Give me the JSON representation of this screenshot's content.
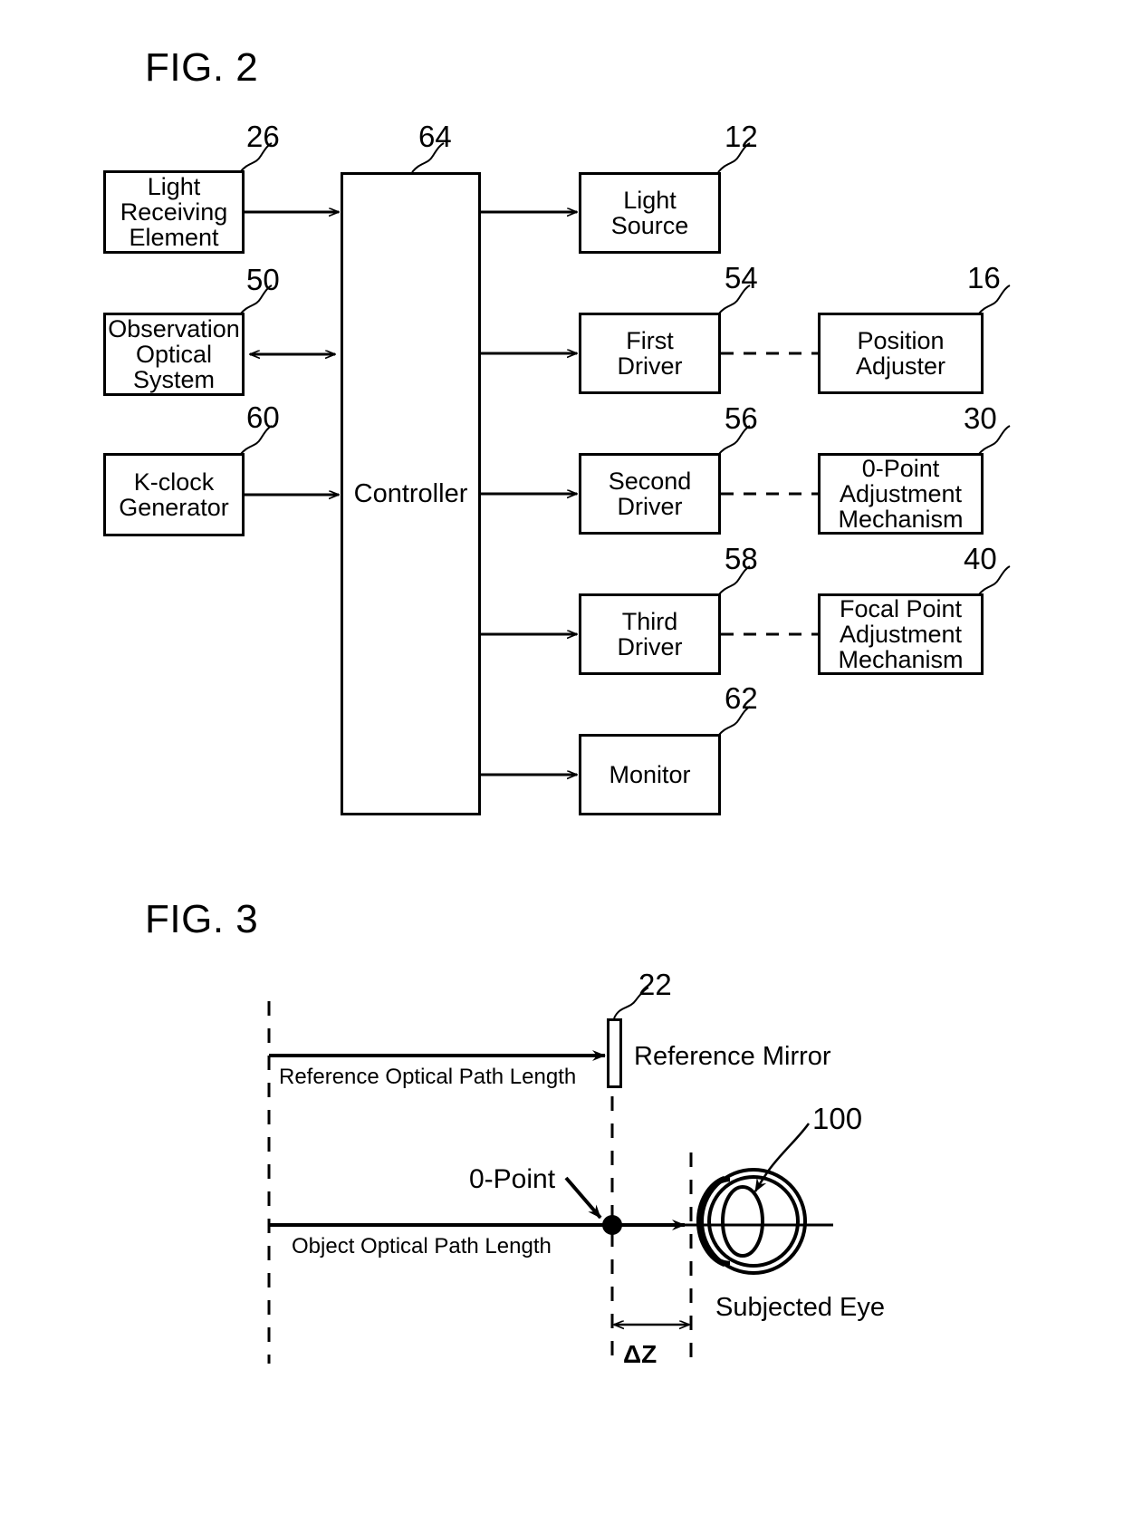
{
  "figures": [
    {
      "id": "fig2",
      "title": "FIG. 2",
      "type": "block-diagram",
      "blocks": [
        {
          "name": "light-receiving-element",
          "label": "Light\nReceiving\nElement",
          "ref": "26",
          "column": "left"
        },
        {
          "name": "observation-optical-system",
          "label": "Observation\nOptical\nSystem",
          "ref": "50",
          "column": "left"
        },
        {
          "name": "k-clock-generator",
          "label": "K-clock\nGenerator",
          "ref": "60",
          "column": "left"
        },
        {
          "name": "controller",
          "label": "Controller",
          "ref": "64",
          "column": "center"
        },
        {
          "name": "light-source",
          "label": "Light\nSource",
          "ref": "12",
          "column": "mid-right"
        },
        {
          "name": "first-driver",
          "label": "First\nDriver",
          "ref": "54",
          "column": "mid-right"
        },
        {
          "name": "second-driver",
          "label": "Second\nDriver",
          "ref": "56",
          "column": "mid-right"
        },
        {
          "name": "third-driver",
          "label": "Third\nDriver",
          "ref": "58",
          "column": "mid-right"
        },
        {
          "name": "monitor",
          "label": "Monitor",
          "ref": "62",
          "column": "mid-right"
        },
        {
          "name": "position-adjuster",
          "label": "Position\nAdjuster",
          "ref": "16",
          "column": "right"
        },
        {
          "name": "zero-point-adjustment-mechanism",
          "label": "0-Point\nAdjustment\nMechanism",
          "ref": "30",
          "column": "right"
        },
        {
          "name": "focal-point-adjustment-mechanism",
          "label": "Focal Point\nAdjustment\nMechanism",
          "ref": "40",
          "column": "right"
        }
      ],
      "connections": [
        {
          "from": "light-receiving-element",
          "to": "controller",
          "style": "solid-arrow"
        },
        {
          "from": "observation-optical-system",
          "to": "controller",
          "style": "solid-double-arrow"
        },
        {
          "from": "k-clock-generator",
          "to": "controller",
          "style": "solid-arrow"
        },
        {
          "from": "controller",
          "to": "light-source",
          "style": "solid-arrow"
        },
        {
          "from": "controller",
          "to": "first-driver",
          "style": "solid-arrow"
        },
        {
          "from": "controller",
          "to": "second-driver",
          "style": "solid-arrow"
        },
        {
          "from": "controller",
          "to": "third-driver",
          "style": "solid-arrow"
        },
        {
          "from": "controller",
          "to": "monitor",
          "style": "solid-arrow"
        },
        {
          "from": "first-driver",
          "to": "position-adjuster",
          "style": "dashed"
        },
        {
          "from": "second-driver",
          "to": "zero-point-adjustment-mechanism",
          "style": "dashed"
        },
        {
          "from": "third-driver",
          "to": "focal-point-adjustment-mechanism",
          "style": "dashed"
        }
      ]
    },
    {
      "id": "fig3",
      "title": "FIG. 3",
      "type": "optical-path-diagram",
      "labels": {
        "reference_path": "Reference Optical Path Length",
        "object_path": "Object Optical Path Length",
        "reference_mirror": "Reference Mirror",
        "reference_mirror_ref": "22",
        "zero_point": "0-Point",
        "eye": "Subjected Eye",
        "eye_ref": "100",
        "delta_z": "ΔZ"
      }
    }
  ]
}
